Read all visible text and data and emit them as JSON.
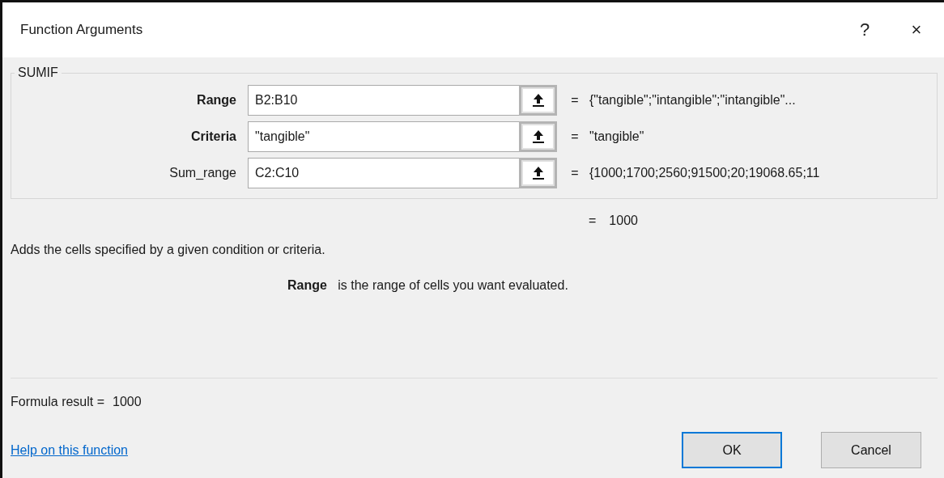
{
  "window": {
    "title": "Function Arguments",
    "help_button": "?",
    "close_button": "×"
  },
  "function_group": {
    "name": "SUMIF",
    "arguments": [
      {
        "label": "Range",
        "required": true,
        "value": "B2:B10",
        "result": "{\"tangible\";\"intangible\";\"intangible\"..."
      },
      {
        "label": "Criteria",
        "required": true,
        "value": "\"tangible\"",
        "result": "\"tangible\""
      },
      {
        "label": "Sum_range",
        "required": false,
        "value": "C2:C10",
        "result": "{1000;1700;2560;91500;20;19068.65;11"
      }
    ]
  },
  "equals_sign": "=",
  "function_result": "1000",
  "description": "Adds the cells specified by a given condition or criteria.",
  "argument_help": "**Range**   is the range of cells you want evaluated.",
  "formula_result": {
    "label": "Formula result =",
    "value": "1000"
  },
  "help_link": "Help on this function",
  "buttons": [
    {
      "label": "OK",
      "default": true
    },
    {
      "label": "Cancel",
      "default": false
    }
  ]
}
